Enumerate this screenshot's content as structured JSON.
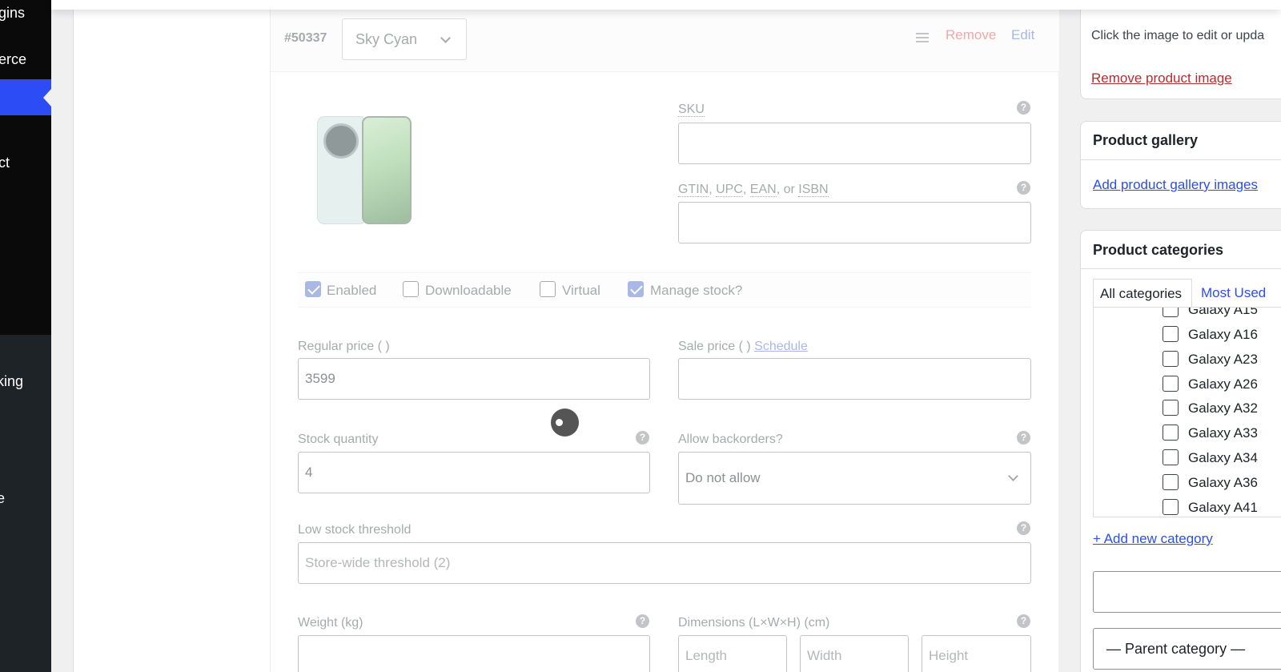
{
  "sidebar": {
    "items": [
      {
        "label": "gins"
      },
      {
        "label": "erce"
      },
      {
        "label": "ct"
      },
      {
        "label": "king"
      },
      {
        "label": "e"
      }
    ]
  },
  "variation": {
    "id": "#50337",
    "color_select": "Sky Cyan",
    "remove_label": "Remove",
    "edit_label": "Edit"
  },
  "fields": {
    "sku_label": "SKU",
    "gtin_label": "GTIN, UPC, EAN, or ISBN",
    "gtin_parts": [
      "GTIN",
      ", ",
      "UPC",
      ", ",
      "EAN",
      ", or ",
      "ISBN"
    ],
    "regular_price_label": "Regular price ( )",
    "regular_price_value": "3599",
    "sale_price_label": "Sale price ( )",
    "schedule_link": "Schedule",
    "stock_qty_label": "Stock quantity",
    "stock_qty_value": "4",
    "backorders_label": "Allow backorders?",
    "backorders_value": "Do not allow",
    "low_stock_label": "Low stock threshold",
    "low_stock_placeholder": "Store-wide threshold (2)",
    "weight_label": "Weight (kg)",
    "dimensions_label": "Dimensions (L×W×H) (cm)",
    "length_placeholder": "Length",
    "width_placeholder": "Width",
    "height_placeholder": "Height"
  },
  "options": [
    {
      "label": "Enabled",
      "checked": true
    },
    {
      "label": "Downloadable",
      "checked": false
    },
    {
      "label": "Virtual",
      "checked": false
    },
    {
      "label": "Manage stock?",
      "checked": true
    }
  ],
  "product_image_box": {
    "hint": "Click the image to edit or upda",
    "remove_link": "Remove product image"
  },
  "gallery": {
    "title": "Product gallery",
    "add_link": "Add product gallery images"
  },
  "categories": {
    "title": "Product categories",
    "tab_all": "All categories",
    "tab_most": "Most Used",
    "items": [
      "Galaxy A15",
      "Galaxy A16",
      "Galaxy A23",
      "Galaxy A26",
      "Galaxy A32",
      "Galaxy A33",
      "Galaxy A34",
      "Galaxy A36",
      "Galaxy A41"
    ],
    "add_link": "+ Add new category",
    "parent_select": "— Parent category —"
  }
}
